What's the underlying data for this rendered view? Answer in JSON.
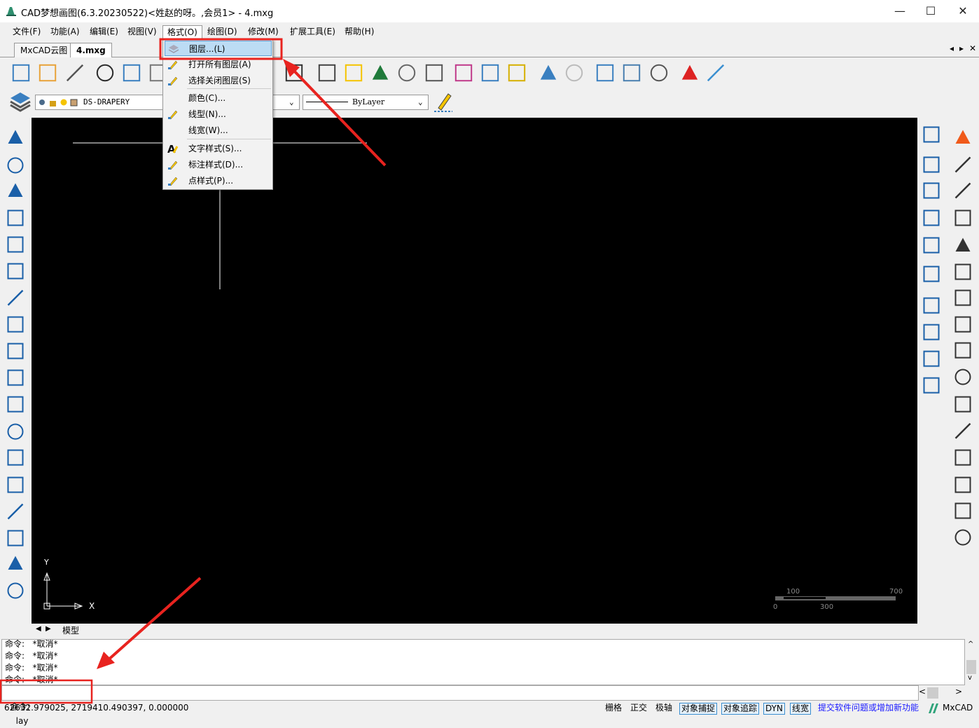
{
  "window": {
    "title": "CAD梦想画图(6.3.20230522)<姓赵的呀。,会员1> - 4.mxg",
    "minimize": "—",
    "maximize": "☐",
    "close": "✕"
  },
  "menubar": [
    {
      "label": "文件(F)"
    },
    {
      "label": "功能(A)"
    },
    {
      "label": "编辑(E)"
    },
    {
      "label": "视图(V)"
    },
    {
      "label": "格式(O)",
      "active": true
    },
    {
      "label": "绘图(D)"
    },
    {
      "label": "修改(M)"
    },
    {
      "label": "扩展工具(E)"
    },
    {
      "label": "帮助(H)"
    }
  ],
  "tabs": [
    {
      "label": "MxCAD云图"
    },
    {
      "label": "4.mxg",
      "active": true
    }
  ],
  "tab_nav": {
    "prev": "◂",
    "next": "▸",
    "close": "✕"
  },
  "format_menu": {
    "items": [
      {
        "label": "图层...(L)",
        "icon": "layers-icon",
        "highlighted": true
      },
      {
        "label": "打开所有图层(A)",
        "icon": "open-layers-icon"
      },
      {
        "label": "选择关闭图层(S)",
        "icon": "close-layer-icon"
      },
      {
        "label": "颜色(C)...",
        "icon": ""
      },
      {
        "label": "线型(N)...",
        "icon": "linetype-pencil-icon"
      },
      {
        "label": "线宽(W)...",
        "icon": ""
      },
      {
        "label": "文字样式(S)...",
        "icon": "text-style-icon"
      },
      {
        "label": "标注样式(D)...",
        "icon": "dim-style-icon"
      },
      {
        "label": "点样式(P)...",
        "icon": "point-style-icon"
      }
    ]
  },
  "layer_bar": {
    "layer_name": "DS-DRAPERY",
    "linetype": "ByLayer"
  },
  "model_tab": {
    "label": "模型"
  },
  "scale_bar": {
    "labels_top": [
      "100",
      "700"
    ],
    "labels_bottom": [
      "0",
      "300"
    ]
  },
  "ucs": {
    "x": "X",
    "y": "Y"
  },
  "command_history": [
    "命令:   *取消*",
    "命令:   *取消*",
    "命令:   *取消*",
    "命令:   *取消*"
  ],
  "command_input": {
    "prompt": "命令:",
    "value": "lay"
  },
  "status": {
    "coords": "62632.979025,  2719410.490397,  0.000000",
    "toggles": [
      {
        "label": "栅格",
        "on": false
      },
      {
        "label": "正交",
        "on": false
      },
      {
        "label": "极轴",
        "on": false
      },
      {
        "label": "对象捕捉",
        "on": true
      },
      {
        "label": "对象追踪",
        "on": true
      },
      {
        "label": "DYN",
        "on": true
      },
      {
        "label": "线宽",
        "on": true
      }
    ],
    "feedback_link": "提交软件问题或增加新功能",
    "brand": "MxCAD"
  },
  "colors": {
    "annotation": "#e8231f",
    "highlight": "#bcdcf4",
    "link": "#1a1aff",
    "canvas": "#000000"
  },
  "toolbar1": [
    "new-file-icon",
    "open-folder-icon",
    "save-icon",
    "open-icon",
    "save-as-icon",
    "zoom-icon",
    "zoom-window-icon",
    "zoom-extents-icon",
    "edit-pencil-icon",
    "table-icon",
    "list-icon",
    "block-icon",
    "color-text-icon",
    "select-icon",
    "match-props-icon",
    "undo-icon",
    "redo-icon",
    "print-icon",
    "globe-icon",
    "web-icon",
    "pdf-icon",
    "image-icon"
  ],
  "left_tools": [
    "line-icon",
    "xline-icon",
    "arc-icon",
    "polygon-icon",
    "pentagon-icon",
    "rectangle-icon",
    "arc3-icon",
    "circle-icon",
    "spline-icon",
    "ellipse-icon",
    "ellipse-arc-icon",
    "point-icon",
    "insert-block-icon",
    "make-block-icon",
    "text-icon",
    "image-insert-icon",
    "mtext-icon",
    "hatch-icon"
  ],
  "right_tools_1": [
    "dim-linear-icon",
    "dim-aligned-icon",
    "dim-radius-icon",
    "dim-diameter-icon",
    "dim-angle-icon",
    "dim-continue-icon",
    "bring-front-icon",
    "send-back-icon",
    "above-object-icon",
    "below-object-icon"
  ],
  "right_tools_2": [
    "erase-icon",
    "copy-icon",
    "move-icon",
    "rotate-icon",
    "scale-icon",
    "stretch-icon",
    "array-icon",
    "mirror-icon",
    "offset-icon",
    "trim-icon",
    "fillet-icon",
    "break-icon",
    "extend-icon",
    "explode-icon",
    "chamfer-icon",
    "join-icon"
  ]
}
